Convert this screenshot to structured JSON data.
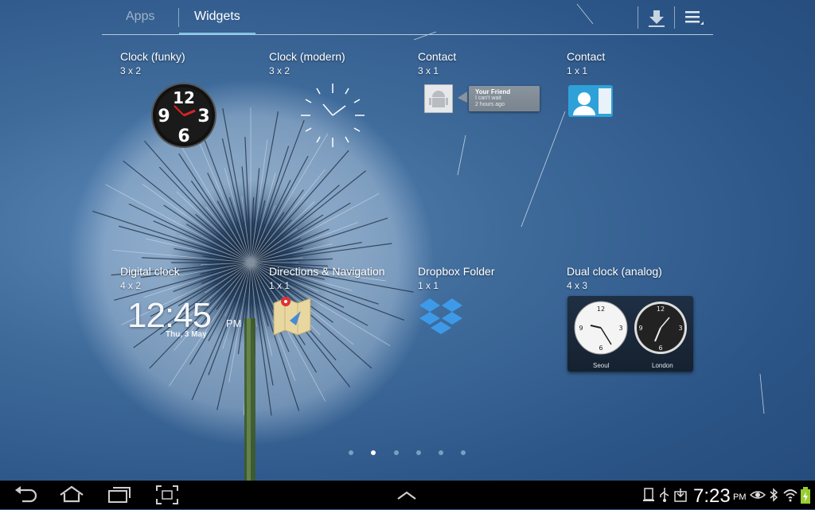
{
  "tabs": {
    "apps_label": "Apps",
    "widgets_label": "Widgets",
    "active": "Widgets"
  },
  "toolbar": {
    "download_icon": "download-icon",
    "menu_icon": "menu-icon"
  },
  "widgets": [
    {
      "name": "Clock (funky)",
      "size": "3 x 2"
    },
    {
      "name": "Clock (modern)",
      "size": "3 x 2"
    },
    {
      "name": "Contact",
      "size": "3 x 1"
    },
    {
      "name": "Contact",
      "size": "1 x 1"
    },
    {
      "name": "Digital clock",
      "size": "4 x 2"
    },
    {
      "name": "Directions & Navigation",
      "size": "1 x 1"
    },
    {
      "name": "Dropbox Folder",
      "size": "1 x 1"
    },
    {
      "name": "Dual clock (analog)",
      "size": "4 x 3"
    }
  ],
  "funky_clock": {
    "digits": [
      "12",
      "9",
      "3",
      "6"
    ]
  },
  "contact_card": {
    "name": "Your Friend",
    "message": "I can't wait",
    "time": "2 hours ago"
  },
  "digital_clock": {
    "time": "12:45",
    "ampm": "PM",
    "date": "Thu, 3 May"
  },
  "dual_clock": {
    "left_city": "Seoul",
    "right_city": "London",
    "dial_numbers": [
      "12",
      "3",
      "6",
      "9"
    ]
  },
  "pagination": {
    "count": 6,
    "active_index": 1
  },
  "status_bar": {
    "time": "7:23",
    "ampm": "PM"
  },
  "colors": {
    "accent": "#7fc4e8",
    "background": "#2c5688",
    "navbar": "#000000"
  }
}
